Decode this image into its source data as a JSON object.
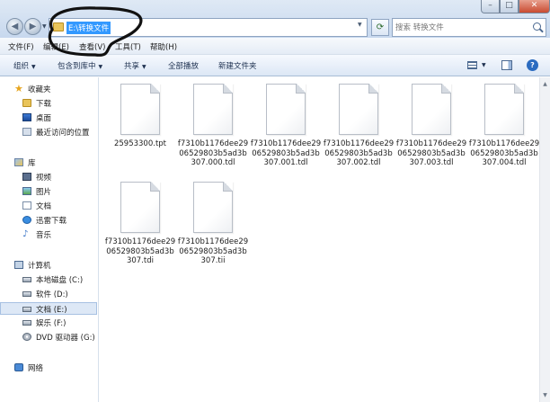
{
  "window": {
    "min_glyph": "–",
    "max_glyph": "□",
    "close_glyph": "✕"
  },
  "address_bar": {
    "path": "E:\\转换文件",
    "refresh_glyph": "⟳"
  },
  "search": {
    "placeholder": "搜索 转换文件"
  },
  "menu": {
    "items": [
      "文件(F)",
      "编辑(E)",
      "查看(V)",
      "工具(T)",
      "帮助(H)"
    ]
  },
  "toolbar": {
    "organize": "组织",
    "include_in_library": "包含到库中",
    "share": "共享",
    "slideshow": "全部播放",
    "new_folder": "新建文件夹"
  },
  "nav": {
    "favorites": "收藏夹",
    "downloads": "下载",
    "desktop": "桌面",
    "recent": "最近访问的位置",
    "libraries": "库",
    "videos": "视频",
    "pictures": "图片",
    "documents": "文档",
    "thunder": "迅雷下载",
    "music": "音乐",
    "computer": "计算机",
    "drive_c": "本地磁盘 (C:)",
    "drive_d": "软件 (D:)",
    "drive_e": "文档 (E:)",
    "drive_f": "娱乐 (F:)",
    "drive_g": "DVD 驱动器 (G:)",
    "network": "网络"
  },
  "files": [
    "25953300.tpt",
    "f7310b1176dee2906529803b5ad3b307.000.tdl",
    "f7310b1176dee2906529803b5ad3b307.001.tdl",
    "f7310b1176dee2906529803b5ad3b307.002.tdl",
    "f7310b1176dee2906529803b5ad3b307.003.tdl",
    "f7310b1176dee2906529803b5ad3b307.004.tdl",
    "f7310b1176dee2906529803b5ad3b307.tdi",
    "f7310b1176dee2906529803b5ad3b307.tii"
  ],
  "colors": {
    "selection": "#3399ff",
    "ink_annotation": "#111111"
  }
}
